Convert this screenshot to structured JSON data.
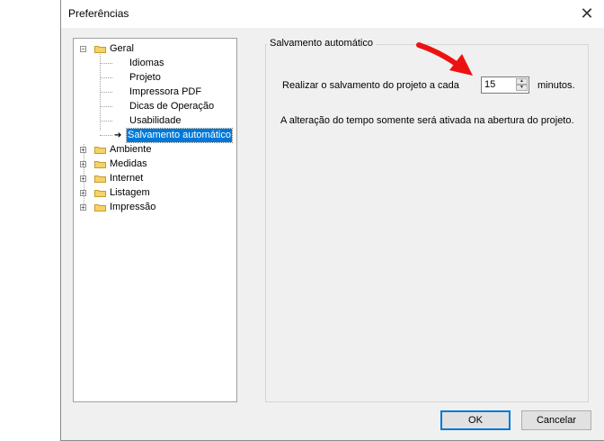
{
  "window": {
    "title": "Preferências"
  },
  "tree": {
    "items": [
      {
        "label": "Geral",
        "expanded": true,
        "children": [
          {
            "label": "Idiomas"
          },
          {
            "label": "Projeto"
          },
          {
            "label": "Impressora PDF"
          },
          {
            "label": "Dicas de Operação"
          },
          {
            "label": "Usabilidade"
          },
          {
            "label": "Salvamento automático",
            "selected": true
          }
        ]
      },
      {
        "label": "Ambiente"
      },
      {
        "label": "Medidas"
      },
      {
        "label": "Internet"
      },
      {
        "label": "Listagem"
      },
      {
        "label": "Impressão"
      }
    ]
  },
  "panel": {
    "title": "Salvamento automático",
    "prompt": "Realizar o salvamento do projeto a cada",
    "interval_value": "15",
    "unit": "minutos.",
    "note": "A alteração do tempo somente será ativada na abertura do projeto."
  },
  "buttons": {
    "ok": "OK",
    "cancel": "Cancelar"
  },
  "colors": {
    "selection": "#0078d7",
    "annotation_arrow": "#ee1111"
  }
}
